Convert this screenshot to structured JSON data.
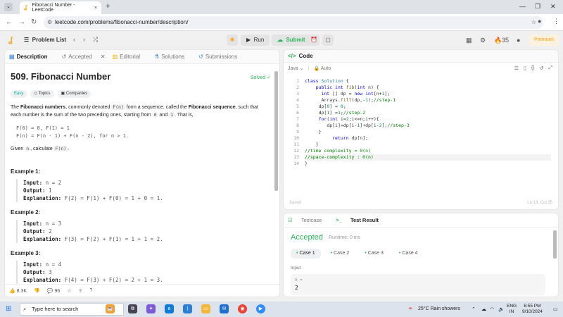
{
  "browser": {
    "tab_title": "Fibonacci Number - LeetCode",
    "url": "leetcode.com/problems/fibonacci-number/description/",
    "new_tab": "+",
    "tab_close": "×"
  },
  "lc_header": {
    "problem_list": "Problem List",
    "run": "Run",
    "submit": "Submit",
    "streak": "35",
    "premium": "Premium"
  },
  "left_tabs": [
    "Description",
    "Accepted",
    "Editorial",
    "Solutions",
    "Submissions"
  ],
  "problem": {
    "title": "509. Fibonacci Number",
    "solved": "Solved",
    "difficulty": "Easy",
    "topics": "Topics",
    "companies": "Companies",
    "desc_1": "The ",
    "desc_bold1": "Fibonacci numbers",
    "desc_2": ", commonly denoted ",
    "desc_code1": "F(n)",
    "desc_3": " form a sequence, called the ",
    "desc_bold2": "Fibonacci sequence",
    "desc_4": ", such that each number is the sum of the two preceding ones, starting from ",
    "desc_code2": "0",
    "desc_5": " and ",
    "desc_code3": "1",
    "desc_6": ". That is,",
    "formula_1": "F(0) = 0, F(1) = 1",
    "formula_2": "F(n) = F(n - 1) + F(n - 2), for n > 1.",
    "given_1": "Given ",
    "given_code1": "n",
    "given_2": ", calculate ",
    "given_code2": "F(n)",
    "given_3": "."
  },
  "examples": [
    {
      "title": "Example 1:",
      "input": "n = 2",
      "output": "1",
      "explanation": "F(2) = F(1) + F(0) = 1 + 0 = 1."
    },
    {
      "title": "Example 2:",
      "input": "n = 3",
      "output": "2",
      "explanation": "F(3) = F(2) + F(1) = 1 + 1 = 2."
    },
    {
      "title": "Example 3:",
      "input": "n = 4",
      "output": "3",
      "explanation": "F(4) = F(3) + F(2) = 2 + 1 = 3."
    }
  ],
  "labels": {
    "input": "Input: ",
    "output": "Output: ",
    "explanation": "Explanation: "
  },
  "footer": {
    "likes": "8.3K",
    "comments": "96"
  },
  "code_panel": {
    "title": "Code",
    "language": "Java",
    "auto": "Auto",
    "saved": "Saved",
    "cursor": "Ln 13, Col 25",
    "lines": [
      "class Solution {",
      "    public int fib(int n) {",
      "      int [] dp = new int[n+1];",
      "      Arrays.fill(dp,-1);//step-1",
      "     dp[0] = 0;",
      "     dp[1] =1;//step-2",
      "     for(int i=2;i<=n;i++){",
      "        dp[i]=dp[i-1]+dp[i-2];//step-3",
      "     }",
      "          return dp[n];",
      "    }",
      "//time complexity = 0(n)",
      "//space-complexity : 0(n)",
      "}"
    ]
  },
  "testcase": {
    "tab1": "Testcase",
    "tab2": "Test Result",
    "status": "Accepted",
    "runtime": "Runtime: 0 ms",
    "cases": [
      "Case 1",
      "Case 2",
      "Case 3",
      "Case 4"
    ],
    "input_label": "Input",
    "var_name": "n =",
    "var_value": "2"
  },
  "taskbar": {
    "search_placeholder": "Type here to search",
    "weather": "25°C  Rain showers",
    "lang1": "ENG",
    "lang2": "IN",
    "time": "6:55 PM",
    "date": "9/10/2024"
  }
}
